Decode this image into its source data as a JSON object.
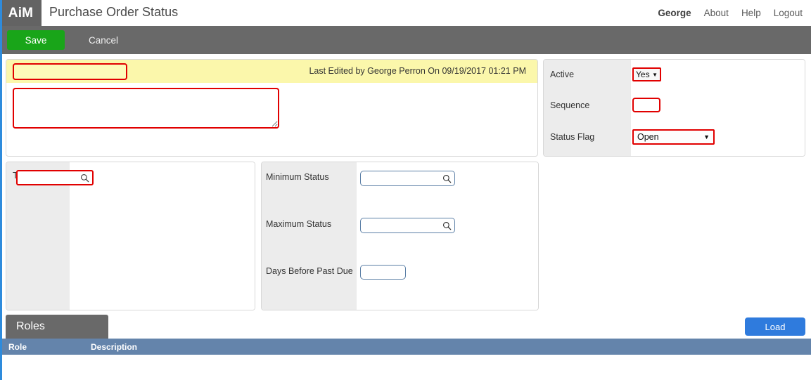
{
  "app": {
    "logo": "AiM",
    "page_title": "Purchase Order Status"
  },
  "topnav": {
    "user": "George",
    "about": "About",
    "help": "Help",
    "logout": "Logout"
  },
  "toolbar": {
    "save_label": "Save",
    "cancel_label": "Cancel"
  },
  "main_panel": {
    "code_value": "",
    "code_placeholder": "",
    "description_value": "",
    "description_placeholder": "",
    "last_edited": "Last Edited by George Perron On 09/19/2017 01:21 PM"
  },
  "side_panel": {
    "active_label": "Active",
    "active_value": "Yes",
    "sequence_label": "Sequence",
    "sequence_value": "",
    "status_flag_label": "Status Flag",
    "status_flag_value": "Open",
    "caret": "▼"
  },
  "type_panel": {
    "type_label": "Type",
    "type_value": "",
    "search_icon": "search-icon"
  },
  "status_panel": {
    "minimum_status_label": "Minimum Status",
    "minimum_status_value": "",
    "maximum_status_label": "Maximum Status",
    "maximum_status_value": "",
    "days_before_past_due_label": "Days Before Past Due",
    "days_before_past_due_value": ""
  },
  "roles": {
    "tab_label": "Roles",
    "load_label": "Load",
    "columns": {
      "role": "Role",
      "description": "Description"
    },
    "rows": []
  },
  "colors": {
    "toolbar_bg": "#696969",
    "save_green": "#19a519",
    "load_blue": "#2f7bdd",
    "table_header_blue": "#6484ab",
    "required_red": "#e10000",
    "yellow_band": "#fbf7ab",
    "label_grey": "#ececec",
    "left_strip_blue": "#2e8bdc"
  }
}
